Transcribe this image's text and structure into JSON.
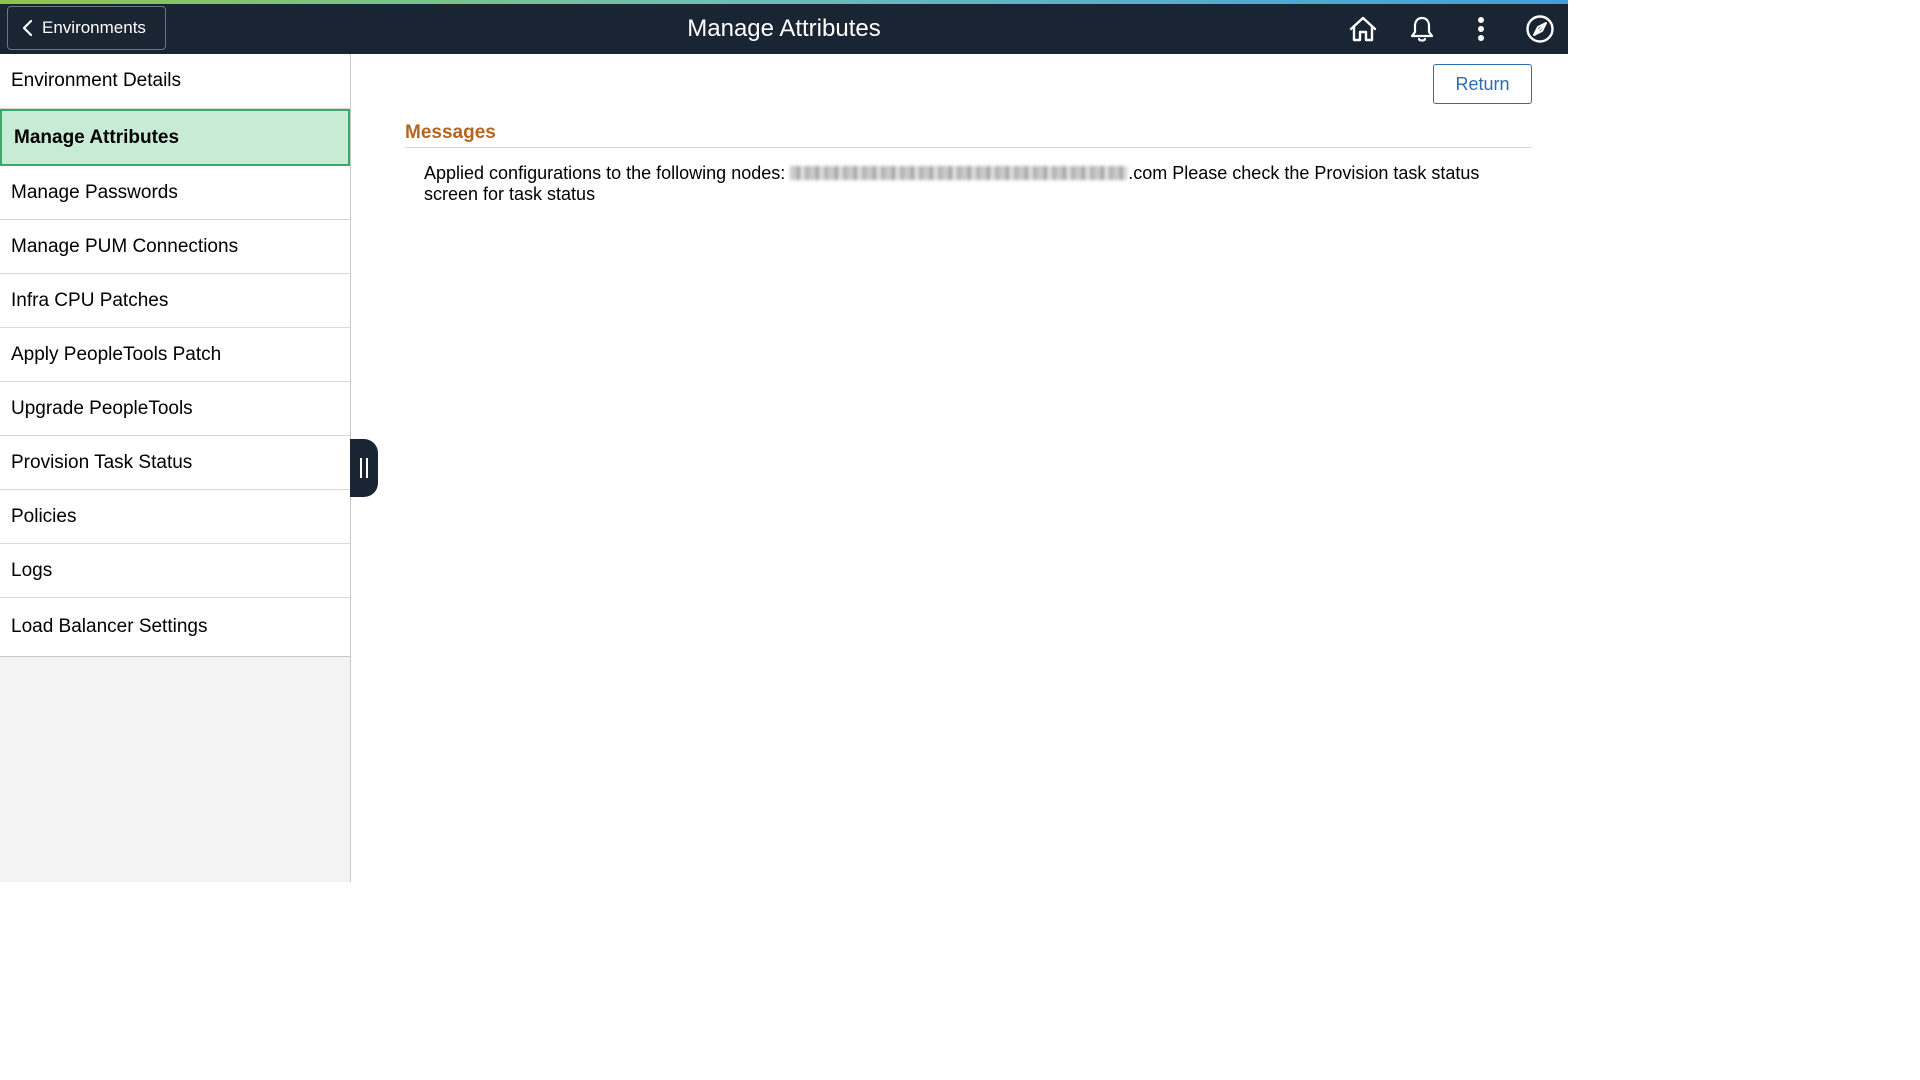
{
  "header": {
    "back_label": "Environments",
    "title": "Manage Attributes",
    "icons": [
      "home-icon",
      "bell-icon",
      "kebab-menu-icon",
      "compass-icon"
    ]
  },
  "sidebar": {
    "items": [
      {
        "label": "Environment Details"
      },
      {
        "label": "Manage Attributes",
        "active": true
      },
      {
        "label": "Manage Passwords"
      },
      {
        "label": "Manage PUM Connections"
      },
      {
        "label": "Infra CPU Patches"
      },
      {
        "label": "Apply PeopleTools Patch"
      },
      {
        "label": "Upgrade PeopleTools"
      },
      {
        "label": "Provision Task Status"
      },
      {
        "label": "Policies"
      },
      {
        "label": "Logs"
      },
      {
        "label": "Load Balancer Settings"
      }
    ]
  },
  "main": {
    "return_label": "Return",
    "messages_title": "Messages",
    "message_prefix": "Applied configurations to the following nodes: ",
    "message_suffix": ".com Please check the Provision task status screen for task status"
  },
  "colors": {
    "header_bg": "#1a2533",
    "active_item_bg": "#c8ebd5",
    "active_item_border": "#3aa867",
    "messages_title": "#b5651d",
    "return_button": "#2d6cb5"
  }
}
